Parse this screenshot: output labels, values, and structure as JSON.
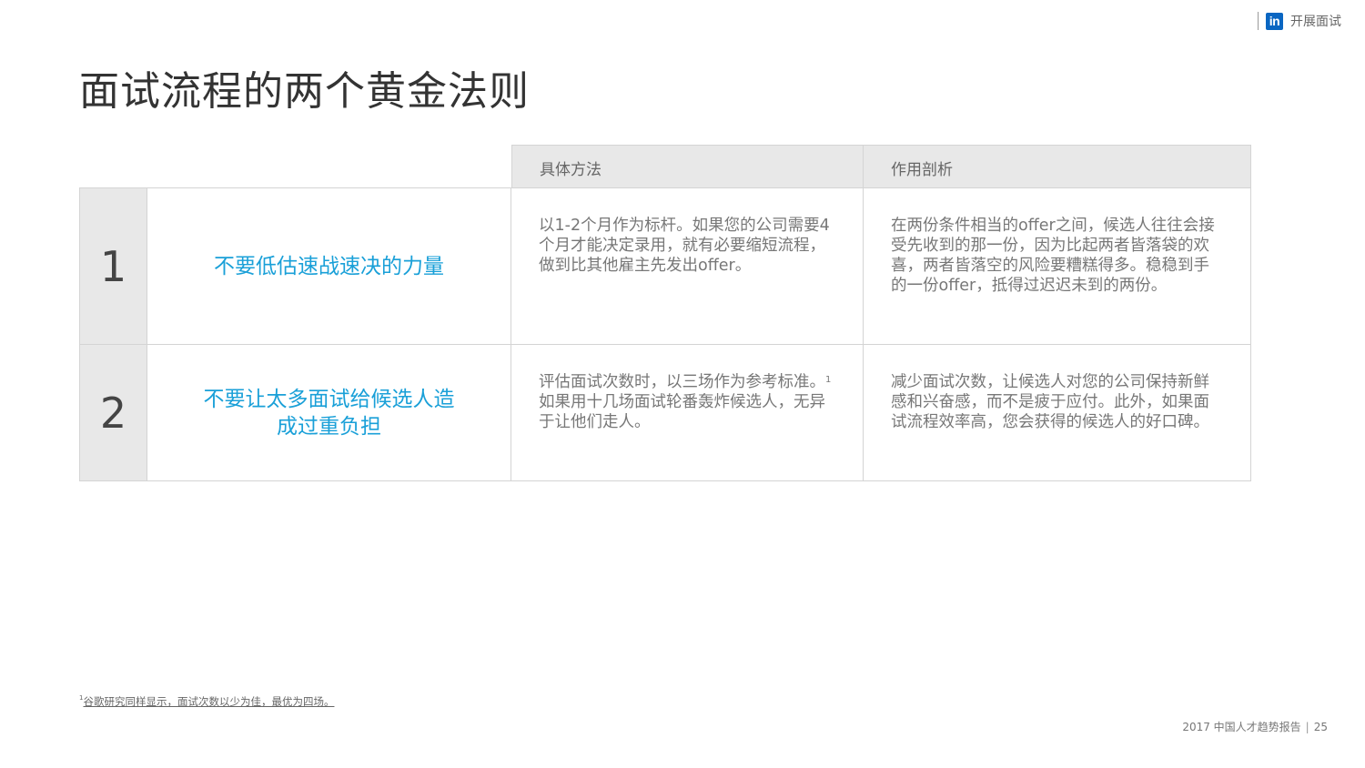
{
  "header": {
    "logo_text": "in",
    "section_label": "开展面试",
    "brand_color": "#0a66c2"
  },
  "title": "面试流程的两个黄金法则",
  "table": {
    "columns": [
      "具体方法",
      "作用剖析"
    ],
    "rows": [
      {
        "number": "1",
        "rule": "不要低估速战速决的力量",
        "method": "以1-2个月作为标杆。如果您的公司需要4个月才能决定录用，就有必要缩短流程，做到比其他雇主先发出offer。",
        "analysis": "在两份条件相当的offer之间，候选人往往会接受先收到的那一份，因为比起两者皆落袋的欢喜，两者皆落空的风险要糟糕得多。稳稳到手的一份offer，抵得过迟迟未到的两份。"
      },
      {
        "number": "2",
        "rule": "不要让太多面试给候选人造成过重负担",
        "method_part1": "评估面试次数时，以三场作为参考标准。",
        "method_sup": "1",
        "method_part2": " 如果用十几场面试轮番轰炸候选人，无异于让他们走人。",
        "analysis": "减少面试次数，让候选人对您的公司保持新鲜感和兴奋感，而不是疲于应付。此外，如果面试流程效率高，您会获得的候选人的好口碑。"
      }
    ],
    "accent_color": "#1aa0d8"
  },
  "footnote": {
    "marker": "1",
    "text": "谷歌研究同样显示，面试次数以少为佳，最优为四场。"
  },
  "footer": {
    "report": "2017 中国人才趋势报告",
    "page": "25"
  }
}
